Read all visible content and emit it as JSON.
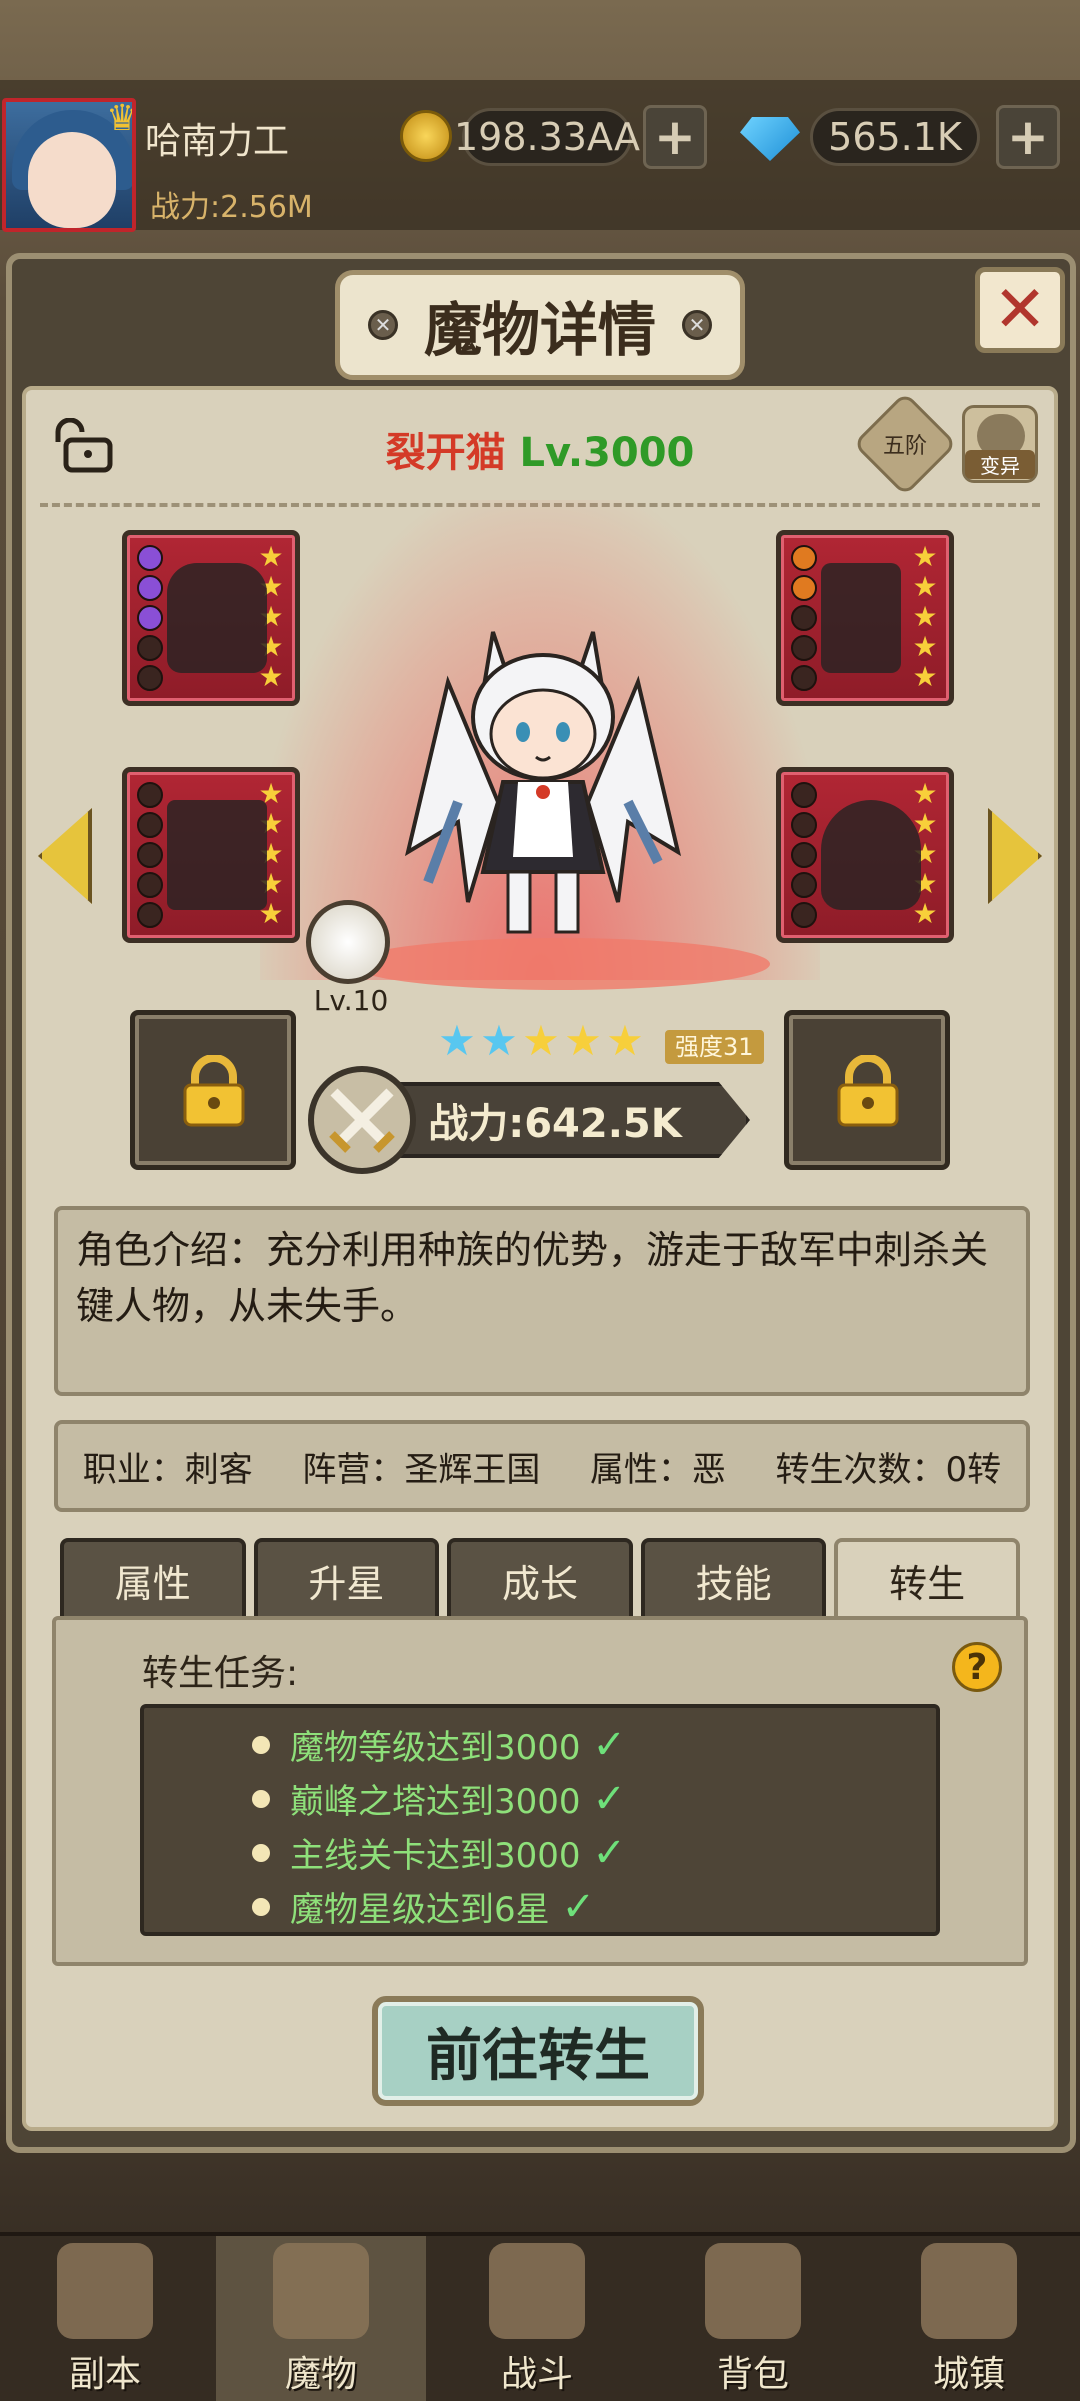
{
  "player": {
    "name": "哈南力工",
    "power": "战力:2.56M"
  },
  "currency": {
    "gold": "198.33AA",
    "gems": "565.1K",
    "plus": "+"
  },
  "dialog": {
    "title": "魔物详情",
    "close": "✕"
  },
  "monster": {
    "name": "裂开猫",
    "level": "Lv.3000",
    "rank_badge": "五阶",
    "mutate_label": "变异",
    "pet_level": "Lv.10",
    "stars": [
      {
        "icon": "★",
        "color": "blue"
      },
      {
        "icon": "★",
        "color": "blue"
      },
      {
        "icon": "★",
        "color": "gold"
      },
      {
        "icon": "★",
        "color": "gold"
      },
      {
        "icon": "★",
        "color": "gold"
      }
    ],
    "strength": "强度31",
    "power": "战力:642.5K",
    "description": "角色介绍：充分利用种族的优势，游走于敌军中刺杀关键人物，从未失手。",
    "info": {
      "class": "职业：刺客",
      "faction": "阵营：圣辉王国",
      "attribute": "属性：恶",
      "rebirth": "转生次数：0转"
    }
  },
  "tabs": [
    "属性",
    "升星",
    "成长",
    "技能",
    "转生"
  ],
  "active_tab": 4,
  "rebirth": {
    "heading": "转生任务:",
    "help": "?",
    "tasks": [
      "魔物等级达到3000",
      "巅峰之塔达到3000",
      "主线关卡达到3000",
      "魔物星级达到6星"
    ],
    "check": "✓",
    "go_button": "前往转生"
  },
  "nav": [
    "副本",
    "魔物",
    "战斗",
    "背包",
    "城镇"
  ],
  "nav_active": 1
}
